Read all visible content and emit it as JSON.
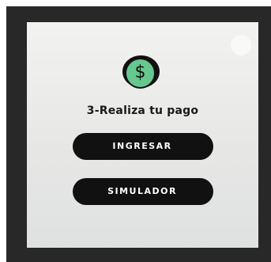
{
  "icon": {
    "name": "dollar-icon",
    "glyph": "$",
    "color": "#66c88f"
  },
  "step": {
    "title": "3-Realiza tu pago"
  },
  "actions": {
    "ingresar_label": "INGRESAR",
    "simulador_label": "SIMULADOR"
  },
  "colors": {
    "frame": "#282828",
    "button": "#111111",
    "accent": "#66c88f"
  }
}
